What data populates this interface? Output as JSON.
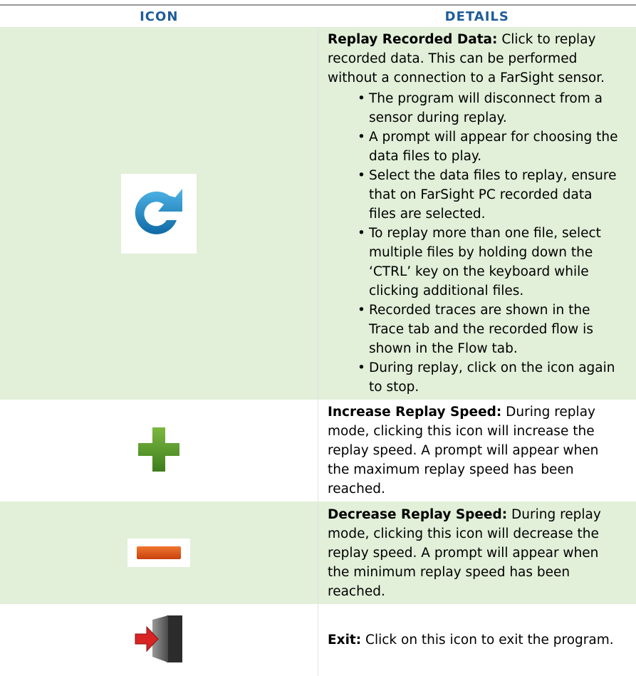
{
  "table": {
    "headers": {
      "icon": "ICON",
      "details": "DETAILS"
    },
    "rows": [
      {
        "icon": "replay-arrow-icon",
        "title": "Replay Recorded Data:",
        "text": " Click to replay recorded data. This can be performed without a connection to a FarSight sensor.",
        "bullets": [
          "The program will disconnect from a sensor during replay.",
          "A prompt will appear for choosing the data files to play.",
          "Select the data files to replay, ensure that on FarSight PC recorded data files are selected.",
          "To replay more than one file, select multiple files by holding down the ‘CTRL’ key on the keyboard while clicking additional files.",
          "Recorded traces are shown in the Trace tab and the recorded flow is shown in the Flow tab.",
          "During replay, click on the icon again to stop."
        ]
      },
      {
        "icon": "plus-icon",
        "title": "Increase Replay Speed:",
        "text": " During replay mode, clicking this icon will increase the replay speed.  A prompt will appear when the maximum replay speed has been reached."
      },
      {
        "icon": "minus-icon",
        "title": "Decrease Replay Speed:",
        "text": " During replay mode, clicking this icon will decrease the replay speed.  A prompt will appear when the minimum replay speed has been reached."
      },
      {
        "icon": "exit-door-icon",
        "title": "Exit:",
        "text": "  Click on this icon to exit the program."
      }
    ]
  },
  "colors": {
    "header_text": "#1f5c99",
    "row_green": "#e2efd9",
    "replay_icon": "#1a86c4",
    "plus_icon": "#5f9a2f",
    "minus_icon": "#e0521a",
    "exit_arrow": "#d92424"
  }
}
